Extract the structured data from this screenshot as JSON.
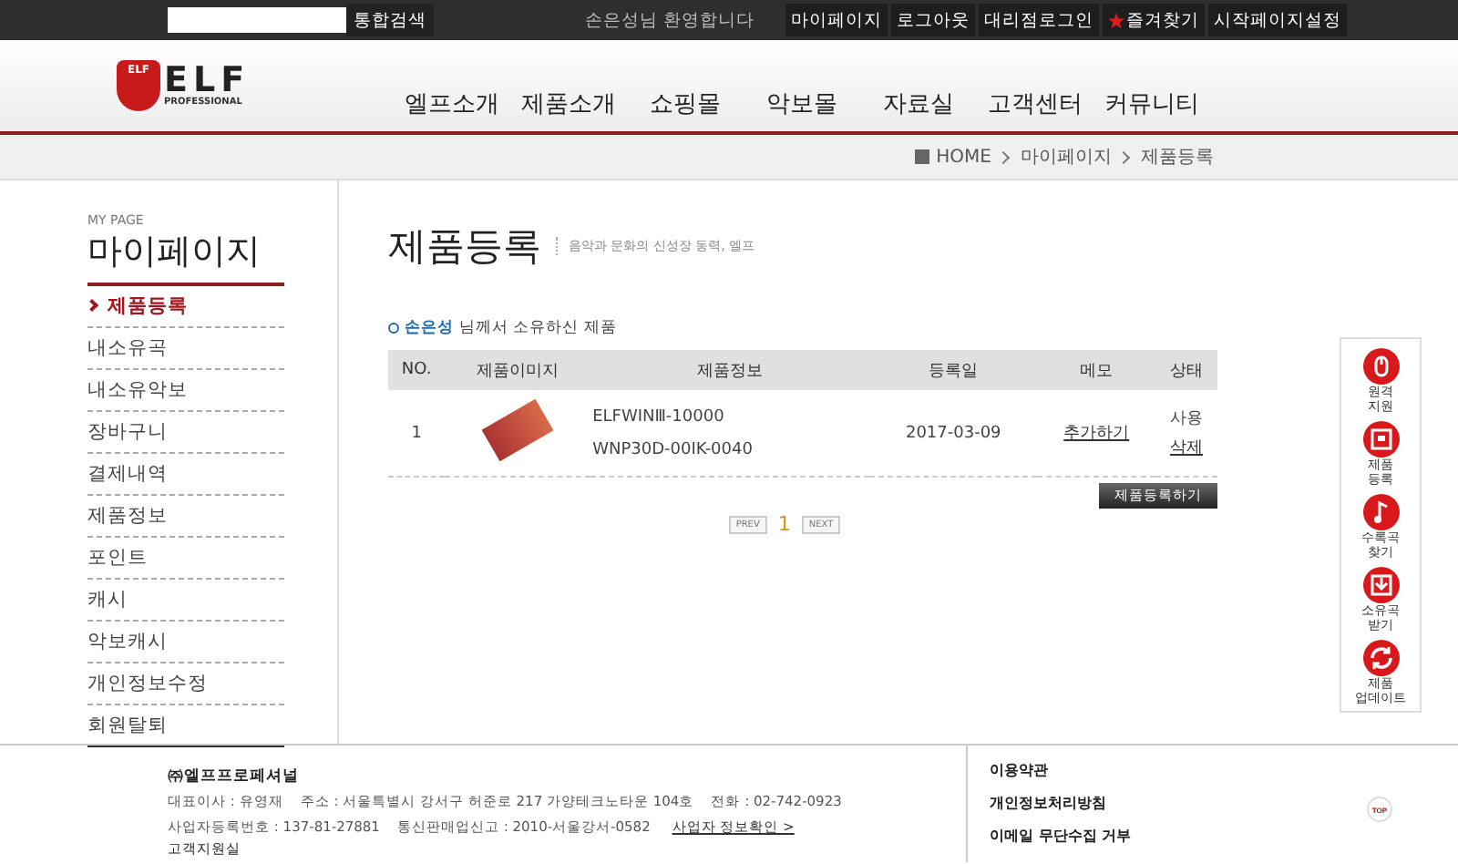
{
  "top_bar": {
    "search_button": "통합검색",
    "welcome": "손은성님 환영합니다",
    "links": [
      {
        "label": "마이페이지",
        "kind": "plain"
      },
      {
        "label": "로그아웃",
        "kind": "plain"
      },
      {
        "label": "대리점로그인",
        "kind": "plain"
      },
      {
        "label": "즐겨찾기",
        "kind": "star"
      },
      {
        "label": "시작페이지설정",
        "kind": "plain"
      }
    ]
  },
  "header": {
    "logo_badge": "ELF",
    "logo_text": "ELF",
    "logo_sub": "PROFESSIONAL",
    "nav": [
      "엘프소개",
      "제품소개",
      "쇼핑몰",
      "악보몰",
      "자료실",
      "고객센터",
      "커뮤니티"
    ]
  },
  "breadcrumb": [
    "HOME",
    "마이페이지",
    "제품등록"
  ],
  "sidebar": {
    "caption": "MY PAGE",
    "title": "마이페이지",
    "items": [
      {
        "label": "제품등록",
        "selected": true
      },
      {
        "label": "내소유곡",
        "selected": false
      },
      {
        "label": "내소유악보",
        "selected": false
      },
      {
        "label": "장바구니",
        "selected": false
      },
      {
        "label": "결제내역",
        "selected": false
      },
      {
        "label": "제품정보",
        "selected": false
      },
      {
        "label": "포인트",
        "selected": false
      },
      {
        "label": "캐시",
        "selected": false
      },
      {
        "label": "악보캐시",
        "selected": false
      },
      {
        "label": "개인정보수정",
        "selected": false
      },
      {
        "label": "회원탈퇴",
        "selected": false
      }
    ]
  },
  "main": {
    "title": "제품등록",
    "subtitle": "음악과 문화의 신성장 동력, 엘프",
    "owner_name": "손은성",
    "owner_suffix": "님께서 소유하신 제품",
    "table": {
      "columns": [
        "NO.",
        "제품이미지",
        "제품정보",
        "등록일",
        "메모",
        "상태"
      ],
      "rows": [
        {
          "no": "1",
          "product_info": [
            "ELFWINⅢ-10000",
            "WNP30D-00IK-0040"
          ],
          "date": "2017-03-09",
          "memo": "추가하기",
          "status": "사용",
          "delete": "삭제"
        }
      ]
    },
    "register_button": "제품등록하기",
    "pagination": {
      "prev": "PREV",
      "page": "1",
      "next": "NEXT"
    }
  },
  "quick_menu": {
    "items": [
      [
        "원격",
        "지원"
      ],
      [
        "제품",
        "등록"
      ],
      [
        "수록곡",
        "찾기"
      ],
      [
        "소유곡",
        "받기"
      ],
      [
        "제품",
        "업데이트"
      ]
    ],
    "top": "TOP"
  },
  "footer": {
    "company": "㈜엘프프로페셔널",
    "lines": [
      "대표이사 : 유영재    주소 : 서울특별시 강서구 허준로 217 가양테크노타운 104호    전화 : 02-742-0923",
      "사업자등록번호 : 137-81-27881    통신판매업신고 : 2010-서울강서-0582"
    ],
    "business_link": "사업자 정보확인 >",
    "support": "고객지원실",
    "links": [
      "이용약관",
      "개인정보처리방침",
      "이메일 무단수집 거부"
    ]
  }
}
